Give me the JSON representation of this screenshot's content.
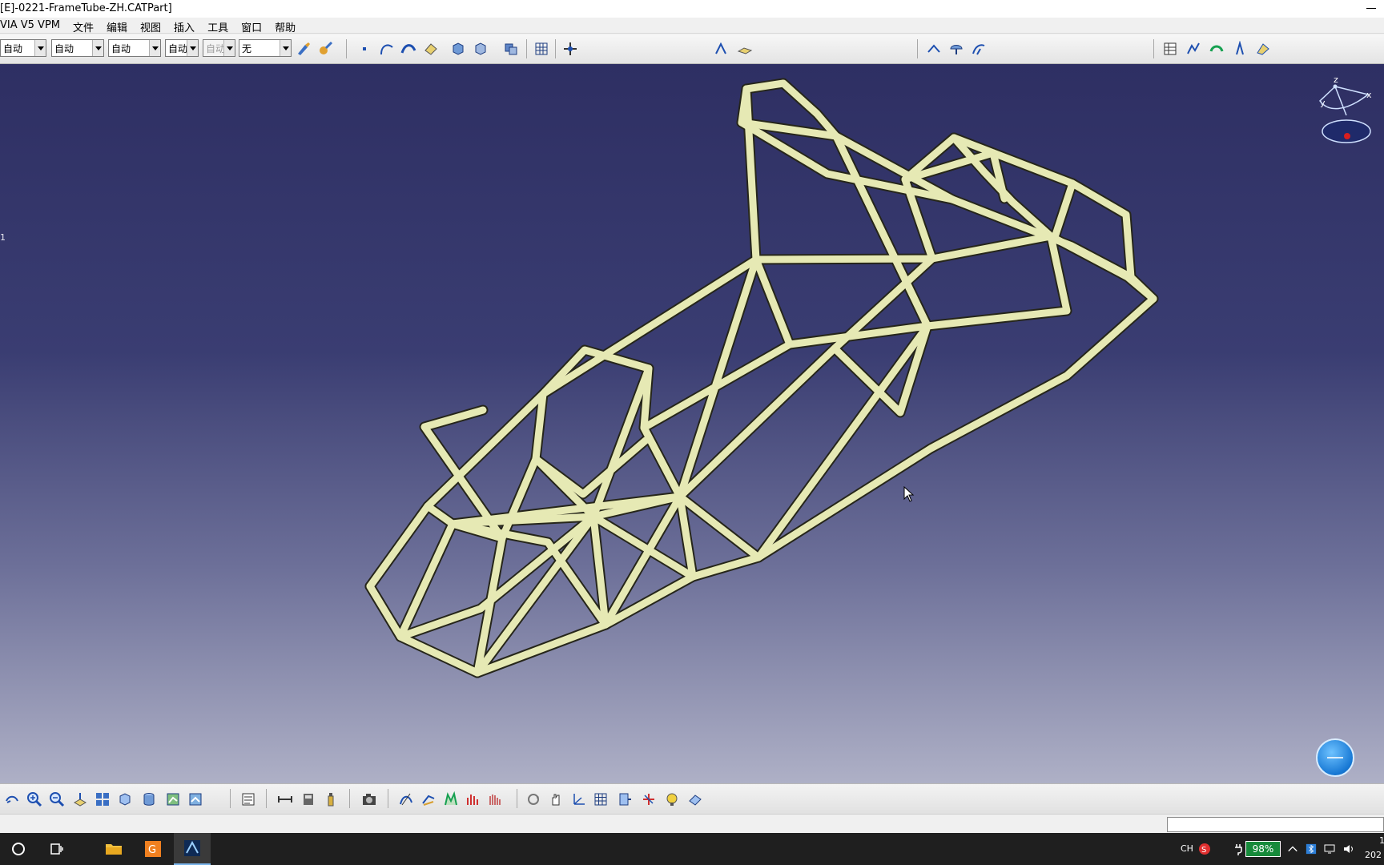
{
  "window": {
    "title": "[E]-0221-FrameTube-ZH.CATPart]"
  },
  "menubar": {
    "items": [
      "VIA V5 VPM",
      "文件",
      "编辑",
      "视图",
      "插入",
      "工具",
      "窗口",
      "帮助"
    ]
  },
  "toolbar_top": {
    "combo_color": "自动",
    "combo_linetype": "自动",
    "combo_lineweight": "自动",
    "combo_layer": "自动",
    "combo_disabled": "自动",
    "combo_none": "无"
  },
  "viewport": {
    "background_top": "#2e2f63",
    "background_bottom": "#aeb0c6",
    "tube_color": "#e6e9b4",
    "side_label": "1",
    "compass_labels": {
      "z": "z",
      "y": "y",
      "x": "x"
    }
  },
  "statusbar": {
    "input_value": ""
  },
  "taskbar": {
    "ime_label": "CH",
    "battery": "98%",
    "clock_line1": "1",
    "clock_line2": "202"
  },
  "icons": {
    "top_toolbar": [
      "brush-icon",
      "painter-icon",
      "point-icon",
      "curve-icon",
      "surface-icon",
      "eraser-icon",
      "cube-front-icon",
      "cube-back-icon",
      "assembly-icon",
      "grid-icon",
      "snap-icon",
      "axis-icon",
      "plane-icon",
      "measure-icon",
      "umbrella-icon",
      "sweep-icon",
      "table-icon",
      "analysis-icon",
      "arc-icon",
      "compass-tool-icon",
      "apply-icon"
    ],
    "bottom_toolbar": [
      "fly-icon",
      "zoom-in-icon",
      "zoom-out-icon",
      "normal-view-icon",
      "multi-view-icon",
      "iso-view-icon",
      "shading-icon",
      "hide-icon",
      "swap-icon",
      "update-icon",
      "dimension-icon",
      "catalog-icon",
      "bottle-icon",
      "camera-icon",
      "analysis-1-icon",
      "analysis-2-icon",
      "analysis-3-icon",
      "analysis-4-icon",
      "analysis-5-icon",
      "rotate-icon",
      "pan-icon",
      "axis-system-icon",
      "grid-icon",
      "work-plane-icon",
      "snap-point-icon",
      "lamp-icon",
      "erase-icon"
    ]
  }
}
